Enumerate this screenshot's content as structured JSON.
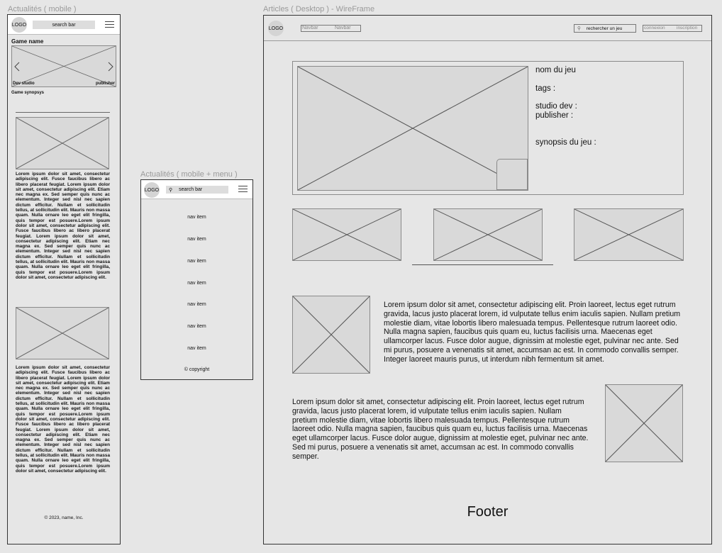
{
  "mobile": {
    "frame_title": "Actualités ( mobile )",
    "logo": "LOGO",
    "search": "search bar",
    "game_name": "Game name",
    "dev_studio": "Dev studio",
    "publisher": "publisher",
    "synopsis": "Game synopsys",
    "lorem1": "Lorem ipsum dolor sit amet, consectetur adipiscing elit. Fusce faucibus libero ac libero placerat feugiat. Lorem ipsum dolor sit amet, consectetur adipiscing elit. Etiam nec magna ex. Sed semper quis nunc ac elementum. Integer sed nisl nec sapien dictum efficitur. Nullam et sollicitudin tellus, at sollicitudin elit. Mauris non massa quam. Nulla ornare leo eget elit fringilla, quis tempor est posuere.Lorem ipsum dolor sit amet, consectetur adipiscing elit. Fusce faucibus libero ac libero placerat feugiat. Lorem ipsum dolor sit amet, consectetur adipiscing elit. Etiam nec magna ex. Sed semper quis nunc ac elementum. Integer sed nisl nec sapien dictum efficitur. Nullam et sollicitudin tellus, at sollicitudin elit. Mauris non massa quam. Nulla ornare leo eget elit fringilla, quis tempor est posuere.Lorem ipsum dolor sit amet, consectetur adipiscing elit.",
    "lorem2": "Lorem ipsum dolor sit amet, consectetur adipiscing elit. Fusce faucibus libero ac libero placerat feugiat. Lorem ipsum dolor sit amet, consectetur adipiscing elit. Etiam nec magna ex. Sed semper quis nunc ac elementum. Integer sed nisl nec sapien dictum efficitur. Nullam et sollicitudin tellus, at sollicitudin elit. Mauris non massa quam. Nulla ornare leo eget elit fringilla, quis tempor est posuere.Lorem ipsum dolor sit amet, consectetur adipiscing elit. Fusce faucibus libero ac libero placerat feugiat. Lorem ipsum dolor sit amet, consectetur adipiscing elit. Etiam nec magna ex. Sed semper quis nunc ac elementum. Integer sed nisl nec sapien dictum efficitur. Nullam et sollicitudin tellus, at sollicitudin elit. Mauris non massa quam. Nulla ornare leo eget elit fringilla, quis tempor est posuere.Lorem ipsum dolor sit amet, consectetur adipiscing elit.",
    "footer": "© 2023, name, Inc."
  },
  "menu": {
    "frame_title": "Actualités ( mobile + menu )",
    "logo": "LOGO",
    "search": "search bar",
    "items": [
      "nav item",
      "nav item",
      "nav item",
      "nav item",
      "nav item",
      "nav item",
      "nav item"
    ],
    "copyright": "© copyright"
  },
  "desktop": {
    "frame_title": "Articles ( Desktop ) - WireFrame",
    "logo": "LOGO",
    "nav1": "Navbar",
    "nav2": "Navbar",
    "search": "rechercher un jeu",
    "login": "connexion",
    "signup": "inscription",
    "game_name": "nom du jeu",
    "tags": "tags :",
    "studio": "studio dev :",
    "publisher": "publisher :",
    "synopsis": "synopsis du jeu :",
    "para1": "Lorem ipsum dolor sit amet, consectetur adipiscing elit. Proin laoreet, lectus eget rutrum gravida, lacus justo placerat lorem, id vulputate tellus enim iaculis sapien. Nullam pretium molestie diam, vitae lobortis libero malesuada tempus. Pellentesque rutrum laoreet odio. Nulla magna sapien, faucibus quis quam eu, luctus facilisis urna. Maecenas eget ullamcorper lacus. Fusce dolor augue, dignissim at molestie eget, pulvinar nec ante. Sed mi purus, posuere a venenatis sit amet, accumsan ac est. In commodo convallis semper. Integer laoreet mauris purus, ut interdum nibh fermentum sit amet.",
    "para2": "Lorem ipsum dolor sit amet, consectetur adipiscing elit. Proin laoreet, lectus eget rutrum gravida, lacus justo placerat lorem, id vulputate tellus enim iaculis sapien. Nullam pretium molestie diam, vitae lobortis libero malesuada tempus. Pellentesque rutrum laoreet odio. Nulla magna sapien, faucibus quis quam eu, luctus facilisis urna. Maecenas eget ullamcorper lacus. Fusce dolor augue, dignissim at molestie eget, pulvinar nec ante. Sed mi purus, posuere a venenatis sit amet, accumsan ac est. In commodo convallis semper.",
    "footer": "Footer"
  }
}
